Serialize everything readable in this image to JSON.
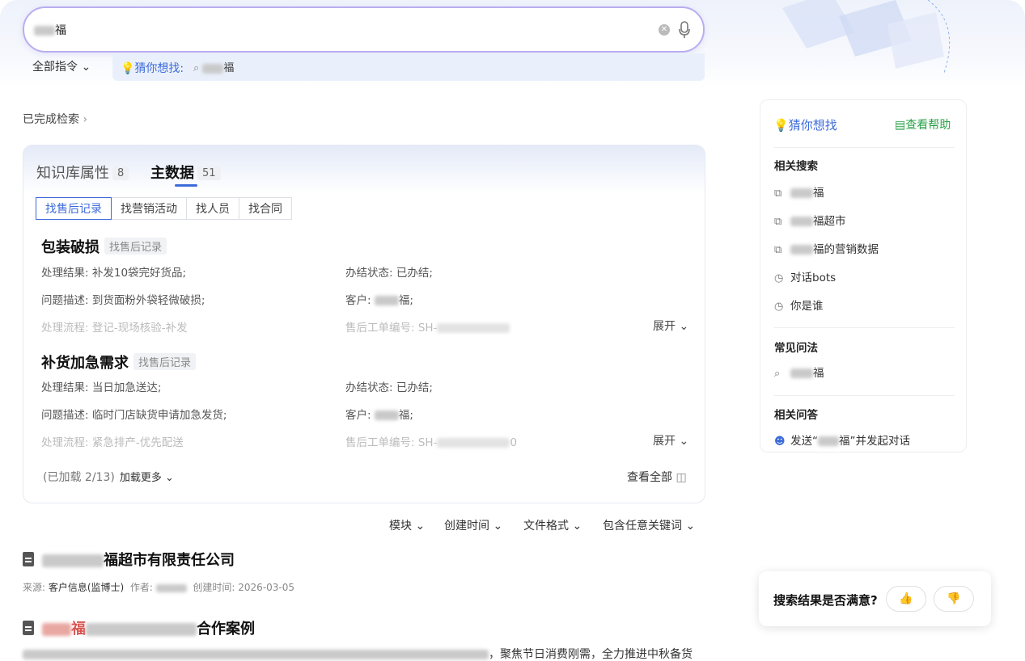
{
  "search": {
    "value_suffix": "福",
    "clear_icon": "clear-icon",
    "mic_icon": "mic-icon"
  },
  "command_bar": {
    "all_commands": "全部指令",
    "guess_label": "猜你想找:",
    "guess_suffix": "福"
  },
  "status": {
    "done": "已完成检索"
  },
  "card": {
    "tabs": [
      {
        "label": "知识库属性",
        "count": "8"
      },
      {
        "label": "主数据",
        "count": "51"
      }
    ],
    "subtabs": [
      "找售后记录",
      "找营销活动",
      "找人员",
      "找合同"
    ],
    "records": [
      {
        "title": "包装破损",
        "tag": "找售后记录",
        "result_label": "处理结果:",
        "result": "补发10袋完好货品;",
        "status_label": "办结状态:",
        "status": "已办结;",
        "desc_label": "问题描述:",
        "desc": "到货面粉外袋轻微破损;",
        "customer_label": "客户:",
        "customer_suffix": "福;",
        "flow_label": "处理流程:",
        "flow": "登记-现场核验-补发",
        "ticket_label": "售后工单编号:",
        "ticket": "SH-",
        "expand": "展开"
      },
      {
        "title": "补货加急需求",
        "tag": "找售后记录",
        "result_label": "处理结果:",
        "result": "当日加急送达;",
        "status_label": "办结状态:",
        "status": "已办结;",
        "desc_label": "问题描述:",
        "desc": "临时门店缺货申请加急发货;",
        "customer_label": "客户:",
        "customer_suffix": "福;",
        "flow_label": "处理流程:",
        "flow": "紧急排产-优先配送",
        "ticket_label": "售后工单编号:",
        "ticket": "SH-",
        "ticket_tail": "0",
        "expand": "展开"
      }
    ],
    "loaded": "(已加载 2/13)",
    "load_more": "加载更多",
    "see_all": "查看全部"
  },
  "filters": [
    "模块",
    "创建时间",
    "文件格式",
    "包含任意关键词"
  ],
  "results": [
    {
      "title_suffix": "福超市有限责任公司",
      "source_label": "来源:",
      "source": "客户信息(监博士)",
      "author_label": "作者:",
      "created_label": "创建时间:",
      "created": "2026-03-05"
    },
    {
      "title_mid": "福",
      "title_suffix": "合作案例",
      "snippet_tail": "，聚焦节日消费刚需，全力推进中秋备货"
    }
  ],
  "sidebar": {
    "title": "猜你想找",
    "help": "查看帮助",
    "related_search": "相关搜索",
    "related_items": [
      "福",
      "福超市",
      "福的营销数据",
      "对话bots",
      "你是谁"
    ],
    "faq": "常见问法",
    "faq_items": [
      "福"
    ],
    "related_qa": "相关问答",
    "qa_prefix": "发送“",
    "qa_suffix": "福”并发起对话"
  },
  "feedback": {
    "question": "搜索结果是否满意?"
  },
  "colors": {
    "accent": "#3c6bd9",
    "help_green": "#2aa147",
    "search_border": "#b8aef0"
  }
}
